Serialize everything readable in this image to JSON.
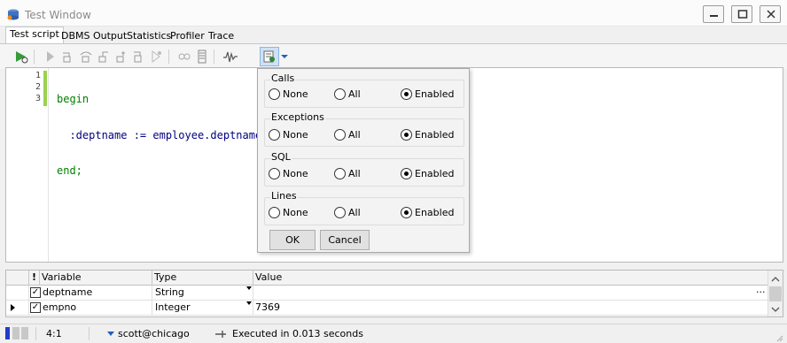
{
  "window": {
    "title": "Test Window"
  },
  "tabs": [
    {
      "label": "Test script",
      "active": true
    },
    {
      "label": "DBMS Output"
    },
    {
      "label": "Statistics"
    },
    {
      "label": "Profiler"
    },
    {
      "label": "Trace"
    }
  ],
  "toolbar": {
    "icons": [
      "execute-icon",
      "run-icon",
      "step-into-icon",
      "step-over-icon",
      "step-out-icon",
      "run-to-exception-icon",
      "run-to-breakpoint-icon",
      "pause-icon",
      "toggle-breakpoint-icon",
      "evaluate-icon",
      "trace-icon",
      "trace-options-icon",
      "dropdown-arrow-icon"
    ]
  },
  "editor": {
    "line_numbers": [
      "1",
      "2",
      "3"
    ],
    "lines": [
      {
        "kw": "begin",
        "text": ""
      },
      {
        "kw": "",
        "text": "  :deptname := employee.deptname"
      },
      {
        "kw": "end;",
        "text": ""
      }
    ]
  },
  "trace_options": {
    "groups": [
      {
        "title": "Calls",
        "options": [
          "None",
          "All",
          "Enabled"
        ],
        "selected": "Enabled"
      },
      {
        "title": "Exceptions",
        "options": [
          "None",
          "All",
          "Enabled"
        ],
        "selected": "Enabled"
      },
      {
        "title": "SQL",
        "options": [
          "None",
          "All",
          "Enabled"
        ],
        "selected": "Enabled"
      },
      {
        "title": "Lines",
        "options": [
          "None",
          "All",
          "Enabled"
        ],
        "selected": "Enabled"
      }
    ],
    "ok_label": "OK",
    "cancel_label": "Cancel"
  },
  "variables": {
    "headers": {
      "marker": "!",
      "variable": "Variable",
      "type": "Type",
      "value": "Value"
    },
    "rows": [
      {
        "checked": true,
        "name": "deptname",
        "type": "String",
        "value": "",
        "current": false,
        "ellipsis": "..."
      },
      {
        "checked": true,
        "name": "empno",
        "type": "Integer",
        "value": "7369",
        "current": true
      }
    ]
  },
  "status": {
    "position": "4:1",
    "connection": "scott@chicago",
    "message": "Executed in 0.013 seconds"
  },
  "colors": {
    "keyword": "#008000",
    "change_bar": "#9ad14f",
    "status_indicator": "#1f3ccc"
  }
}
